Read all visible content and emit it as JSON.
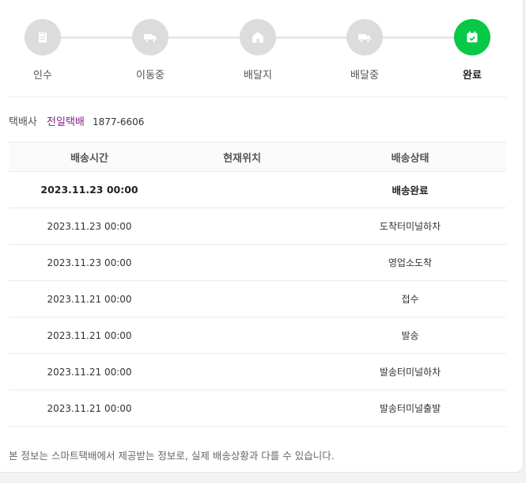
{
  "steps": [
    {
      "label": "인수",
      "icon": "clipboard-icon",
      "active": false
    },
    {
      "label": "이동중",
      "icon": "truck-icon",
      "active": false
    },
    {
      "label": "배달지",
      "icon": "house-icon",
      "active": false
    },
    {
      "label": "배달중",
      "icon": "truck-icon",
      "active": false
    },
    {
      "label": "완료",
      "icon": "calendar-check-icon",
      "active": true
    }
  ],
  "carrier": {
    "label": "택배사",
    "name": "전일택배",
    "phone": "1877-6606"
  },
  "table": {
    "headers": [
      "배송시간",
      "현재위치",
      "배송상태"
    ],
    "rows": [
      {
        "time": "2023.11.23 00:00",
        "location": "",
        "status": "배송완료"
      },
      {
        "time": "2023.11.23 00:00",
        "location": "",
        "status": "도착터미널하차"
      },
      {
        "time": "2023.11.23 00:00",
        "location": "",
        "status": "영업소도착"
      },
      {
        "time": "2023.11.21 00:00",
        "location": "",
        "status": "접수"
      },
      {
        "time": "2023.11.21 00:00",
        "location": "",
        "status": "발송"
      },
      {
        "time": "2023.11.21 00:00",
        "location": "",
        "status": "발송터미널하차"
      },
      {
        "time": "2023.11.21 00:00",
        "location": "",
        "status": "발송터미널출발"
      }
    ]
  },
  "notice": "본 정보는 스마트택배에서 제공받는 정보로, 실제 배송상황과 다를 수 있습니다.",
  "colors": {
    "active": "#07c847",
    "inactive": "#dcdcdc",
    "carrier_name": "#8a1f8a"
  }
}
